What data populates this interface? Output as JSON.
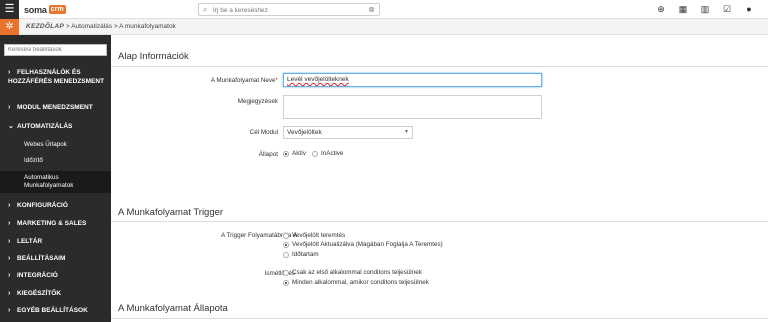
{
  "topbar": {
    "logo_text": "soma",
    "logo_badge": "crm",
    "search_placeholder": "Írj be a kereséshez",
    "icons": [
      "plus-circle-icon",
      "calendar-icon",
      "bar-chart-icon",
      "checkbox-icon",
      "user-icon"
    ]
  },
  "breadcrumb": {
    "home": "KEZDŐLAP",
    "path": "> Automatizálás > A munkafolyamatok"
  },
  "sidebar": {
    "search_placeholder": "Keresési beállítások",
    "items": [
      {
        "label": "FELHASZNÁLÓK ÉS HOZZÁFÉRÉS MENEDZSMENT",
        "chev": "›"
      },
      {
        "label": "MODUL MENEDZSMENT",
        "chev": "›"
      },
      {
        "label": "AUTOMATIZÁLÁS",
        "chev": "⌄"
      },
      {
        "label": "KONFIGURÁCIÓ",
        "chev": "›"
      },
      {
        "label": "MARKETING & SALES",
        "chev": "›"
      },
      {
        "label": "LELTÁR",
        "chev": "›"
      },
      {
        "label": "BEÁLLÍTÁSAIM",
        "chev": "›"
      },
      {
        "label": "INTEGRÁCIÓ",
        "chev": "›"
      },
      {
        "label": "KIEGÉSZÍTŐK",
        "chev": "›"
      },
      {
        "label": "EGYÉB BEÁLLÍTÁSOK",
        "chev": "›"
      }
    ],
    "subitems": [
      {
        "label": "Webes Űrlapok"
      },
      {
        "label": "Időzítő"
      },
      {
        "label": "Automatikus Munkafolyamatok"
      }
    ]
  },
  "basic": {
    "title": "Alap Információk",
    "name_label": "A Munkafolyamat Neve",
    "name_required": "*",
    "name_value": "Levél vevőjelölteknek",
    "notes_label": "Megjegyzések",
    "notes_value": "",
    "module_label": "Cél Modul",
    "module_value": "Vevőjelöltek",
    "status_label": "Állapot",
    "status_active": "Aktív",
    "status_inactive": "InActive",
    "status_selected": "Aktív"
  },
  "trigger": {
    "title": "A Munkafolyamat Trigger",
    "trigger_label": "A Trigger Folyamatábrája A",
    "trigger_options": [
      "Vevőjelölt teremtés",
      "Vevőjelölt Aktualizálva  (Magában Foglalja A Teremtes)",
      "Időtartam"
    ],
    "trigger_selected": 1,
    "repeat_label": "Ismétlődés",
    "repeat_options": [
      "Csak az első alkalommal conditons teljesülnek",
      "Minden alkalommal, amikor conditons teljesülnek"
    ],
    "repeat_selected": 1
  },
  "status_section": {
    "title": "A Munkafolyamat Állapota"
  }
}
